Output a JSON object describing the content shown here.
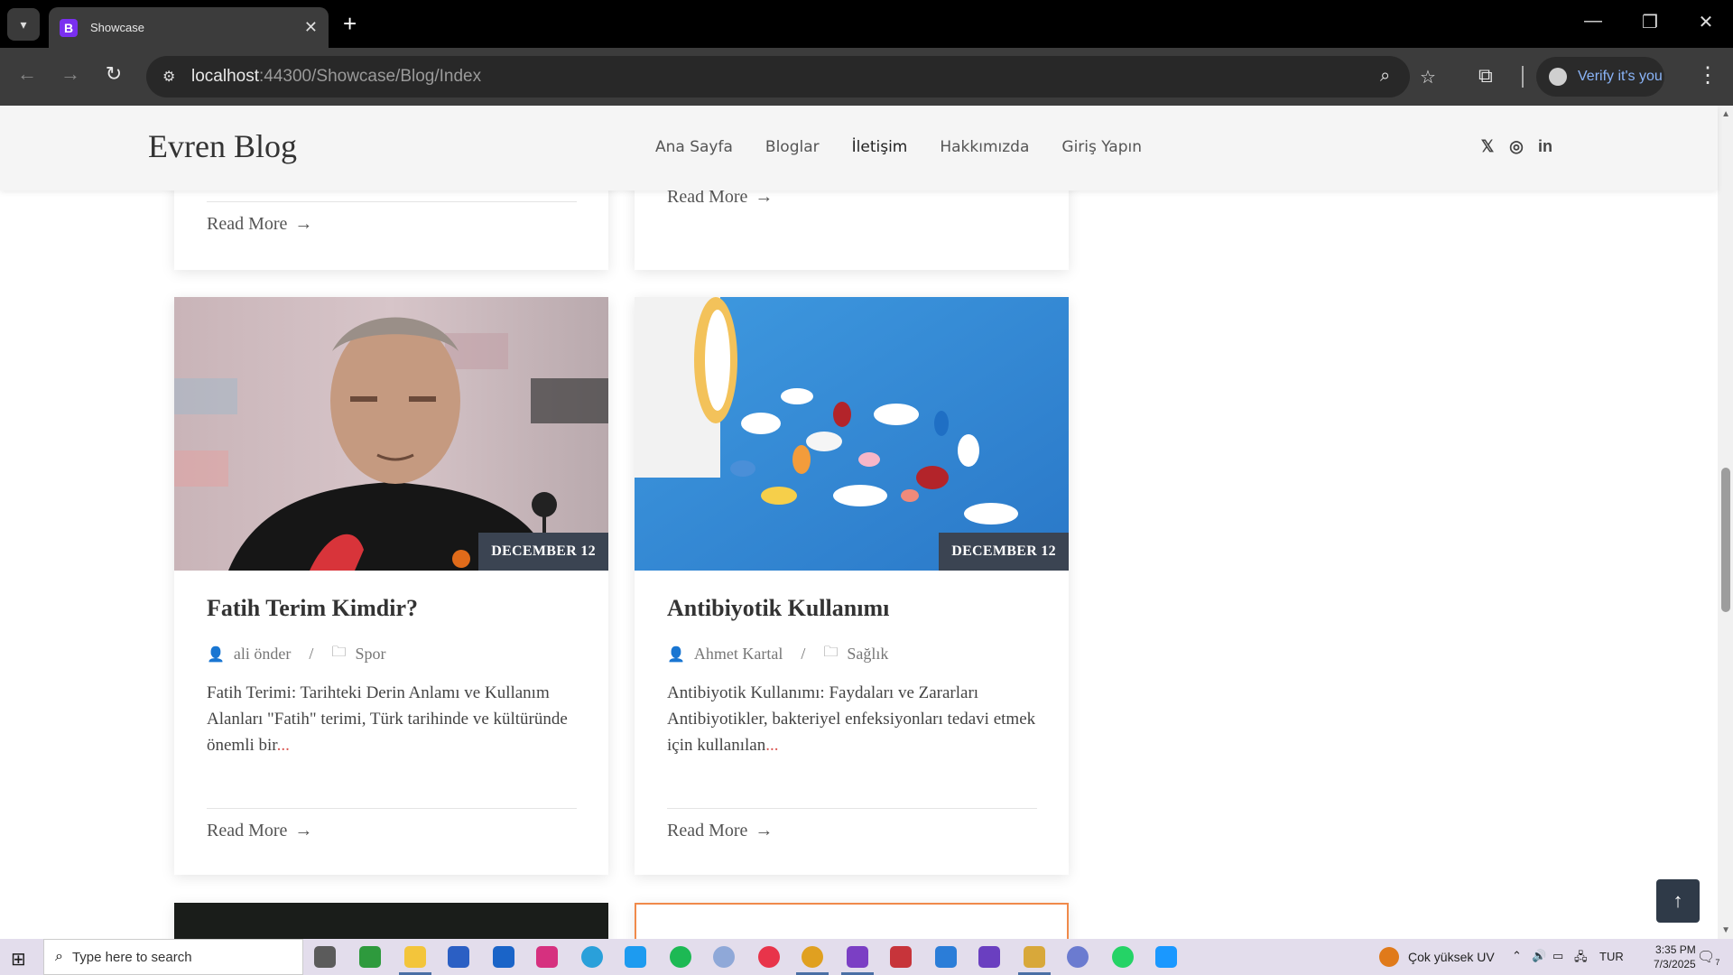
{
  "browser": {
    "tab_title": "Showcase",
    "tab_favicon_letter": "B",
    "url_host": "localhost",
    "url_path": ":44300/Showcase/Blog/Index",
    "verify_label": "Verify it's you"
  },
  "site": {
    "logo": "Evren Blog",
    "nav": [
      "Ana Sayfa",
      "Bloglar",
      "İletişim",
      "Hakkımızda",
      "Giriş Yapın"
    ],
    "social_icons": [
      "x-icon",
      "instagram-icon",
      "linkedin-icon"
    ]
  },
  "posts": [
    {
      "date_badge": "DECEMBER 12",
      "title": "Fatih Terim Kimdir?",
      "author": "ali önder",
      "category": "Spor",
      "excerpt": "Fatih Terimi: Tarihteki Derin Anlamı ve Kullanım Alanları \"Fatih\" terimi, Türk tarihinde ve kültüründe önemli bir",
      "ellipsis": "...",
      "read_more": "Read More"
    },
    {
      "date_badge": "DECEMBER 12",
      "title": "Antibiyotik Kullanımı",
      "author": "Ahmet Kartal",
      "category": "Sağlık",
      "excerpt": "Antibiyotik Kullanımı: Faydaları ve Zararları Antibiyotikler, bakteriyel enfeksiyonları tedavi etmek için kullanılan",
      "ellipsis": "...",
      "read_more": "Read More"
    }
  ],
  "previous_cards": {
    "read_more": "Read More"
  },
  "taskbar": {
    "search_placeholder": "Type here to search",
    "weather": "Çok yüksek UV",
    "language": "TUR",
    "time": "3:35 PM",
    "date": "7/3/2025",
    "notification_count": "7"
  },
  "colors": {
    "badge_bg": "#3b4452",
    "ellipsis": "#d9534f",
    "verify_text": "#8ab4f8",
    "tab_favicon": "#7a2ff0"
  }
}
